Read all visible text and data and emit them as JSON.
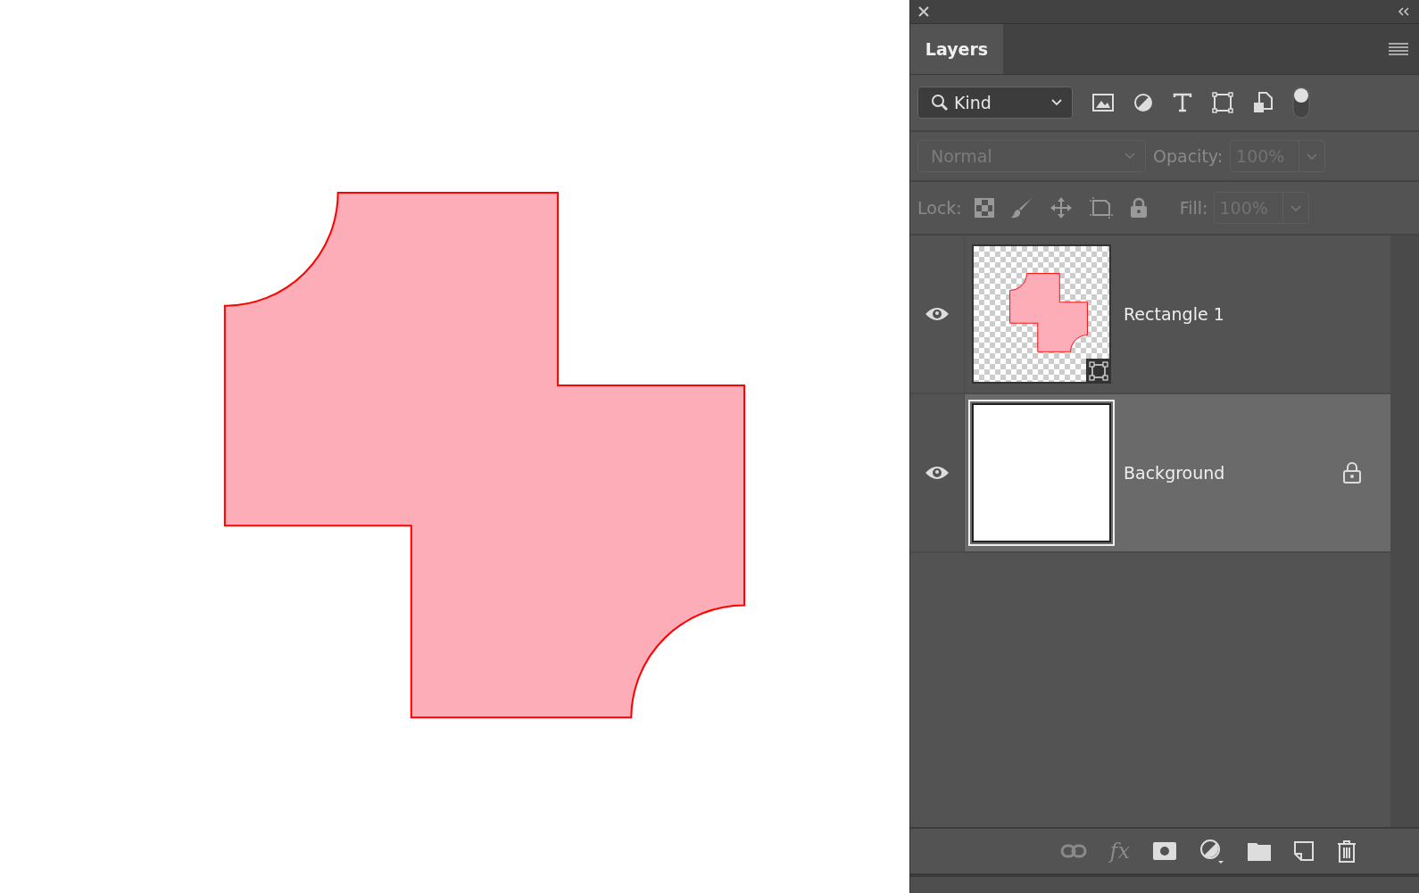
{
  "panel": {
    "tab": {
      "label": "Layers",
      "selected": true
    },
    "filter": {
      "value": "Kind",
      "on": true
    },
    "blend_mode": {
      "value": "Normal",
      "disabled": true
    },
    "opacity": {
      "label": "Opacity:",
      "value": "100%",
      "disabled": true
    },
    "lock": {
      "label": "Lock:",
      "disabled": true
    },
    "fill": {
      "label": "Fill:",
      "value": "100%",
      "disabled": true
    },
    "layers": [
      {
        "name": "Rectangle 1",
        "kind": "shape",
        "visible": true,
        "selected": false,
        "locked": false
      },
      {
        "name": "Background",
        "kind": "background",
        "visible": true,
        "selected": true,
        "locked": true
      }
    ],
    "footer": {
      "effects": "fx"
    }
  }
}
